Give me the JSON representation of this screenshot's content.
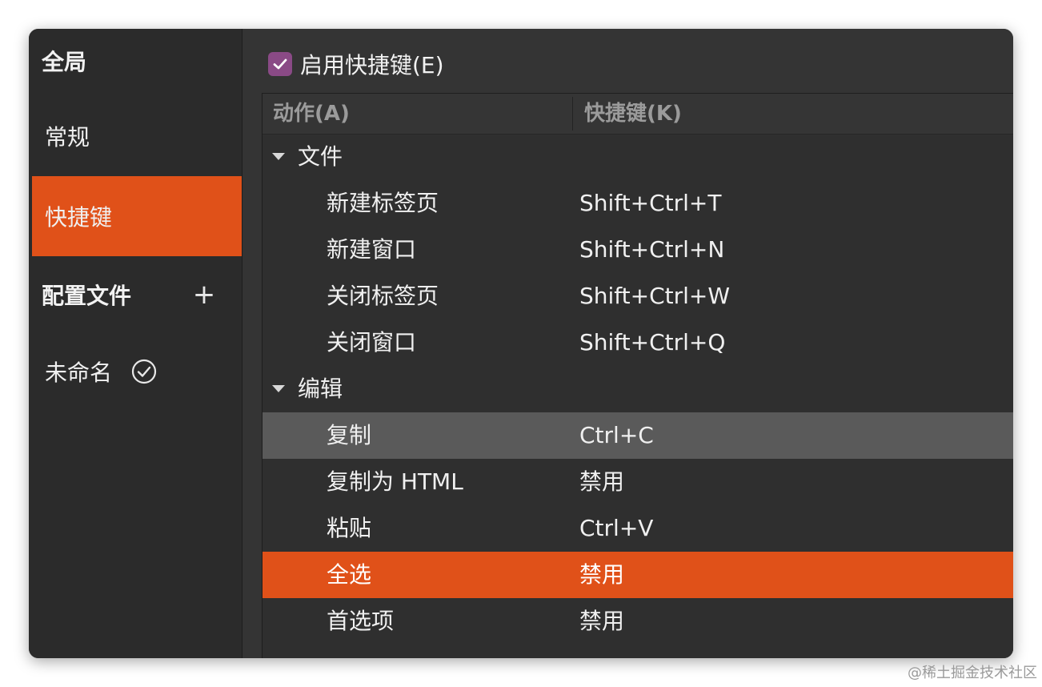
{
  "sidebar": {
    "global_heading": "全局",
    "items": [
      {
        "label": "常规"
      },
      {
        "label": "快捷键"
      }
    ],
    "profiles_heading": "配置文件",
    "add_profile_symbol": "+",
    "profile": {
      "label": "未命名"
    }
  },
  "main": {
    "enable_shortcuts_label": "启用快捷键(E)",
    "enable_shortcuts_checked": true,
    "columns": {
      "action": "动作(A)",
      "shortcut": "快捷键(K)"
    },
    "rows": [
      {
        "type": "category",
        "label": "文件"
      },
      {
        "type": "item",
        "action": "新建标签页",
        "shortcut": "Shift+Ctrl+T"
      },
      {
        "type": "item",
        "action": "新建窗口",
        "shortcut": "Shift+Ctrl+N"
      },
      {
        "type": "item",
        "action": "关闭标签页",
        "shortcut": "Shift+Ctrl+W"
      },
      {
        "type": "item",
        "action": "关闭窗口",
        "shortcut": "Shift+Ctrl+Q"
      },
      {
        "type": "category",
        "label": "编辑"
      },
      {
        "type": "item",
        "action": "复制",
        "shortcut": "Ctrl+C",
        "state": "hover"
      },
      {
        "type": "item",
        "action": "复制为 HTML",
        "shortcut": "禁用"
      },
      {
        "type": "item",
        "action": "粘贴",
        "shortcut": "Ctrl+V"
      },
      {
        "type": "item",
        "action": "全选",
        "shortcut": "禁用",
        "state": "selected"
      },
      {
        "type": "item",
        "action": "首选项",
        "shortcut": "禁用"
      }
    ]
  },
  "colors": {
    "accent": "#e05119",
    "checkbox": "#8a4a86",
    "window_bg": "#303030"
  },
  "watermark": "@稀土掘金技术社区"
}
